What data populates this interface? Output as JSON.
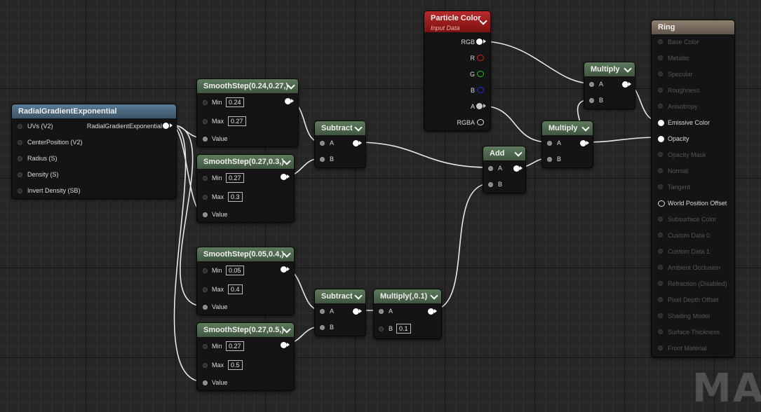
{
  "editor": {
    "watermark": "MAT"
  },
  "nodes": {
    "radial": {
      "title": "RadialGradientExponential",
      "inputs": [
        "UVs (V2)",
        "CenterPosition (V2)",
        "Radius (S)",
        "Density (S)",
        "Invert Density (SB)"
      ],
      "output": "RadialGradientExponential"
    },
    "ss1": {
      "title": "SmoothStep(0.24,0.27,)",
      "min_label": "Min",
      "min_value": "0.24",
      "max_label": "Max",
      "max_value": "0.27",
      "value_label": "Value"
    },
    "ss2": {
      "title": "SmoothStep(0.27,0.3,)",
      "min_label": "Min",
      "min_value": "0.27",
      "max_label": "Max",
      "max_value": "0.3",
      "value_label": "Value"
    },
    "ss3": {
      "title": "SmoothStep(0.05,0.4,)",
      "min_label": "Min",
      "min_value": "0.05",
      "max_label": "Max",
      "max_value": "0.4",
      "value_label": "Value"
    },
    "ss4": {
      "title": "SmoothStep(0.27,0.5,)",
      "min_label": "Min",
      "min_value": "0.27",
      "max_label": "Max",
      "max_value": "0.5",
      "value_label": "Value"
    },
    "sub1": {
      "title": "Subtract",
      "a": "A",
      "b": "B"
    },
    "sub2": {
      "title": "Subtract",
      "a": "A",
      "b": "B"
    },
    "mulconst": {
      "title": "Multiply(,0.1)",
      "a": "A",
      "b": "B",
      "b_value": "0.1"
    },
    "add": {
      "title": "Add",
      "a": "A",
      "b": "B"
    },
    "particle": {
      "title": "Particle Color",
      "subtitle": "Input Data",
      "outputs": [
        "RGB",
        "R",
        "G",
        "B",
        "A",
        "RGBA"
      ]
    },
    "mul_top": {
      "title": "Multiply",
      "a": "A",
      "b": "B"
    },
    "mul_mid": {
      "title": "Multiply",
      "a": "A",
      "b": "B"
    },
    "ring": {
      "title": "Ring",
      "inputs": [
        {
          "label": "Base Color",
          "active": false
        },
        {
          "label": "Metallic",
          "active": false
        },
        {
          "label": "Specular",
          "active": false
        },
        {
          "label": "Roughness",
          "active": false
        },
        {
          "label": "Anisotropy",
          "active": false
        },
        {
          "label": "Emissive Color",
          "active": true
        },
        {
          "label": "Opacity",
          "active": true
        },
        {
          "label": "Opacity Mask",
          "active": false
        },
        {
          "label": "Normal",
          "active": false
        },
        {
          "label": "Tangent",
          "active": false
        },
        {
          "label": "World Position Offset",
          "active": true
        },
        {
          "label": "Subsurface Color",
          "active": false
        },
        {
          "label": "Custom Data 0",
          "active": false
        },
        {
          "label": "Custom Data 1",
          "active": false
        },
        {
          "label": "Ambient Occlusion",
          "active": false
        },
        {
          "label": "Refraction (Disabled)",
          "active": false
        },
        {
          "label": "Pixel Depth Offset",
          "active": false
        },
        {
          "label": "Shading Model",
          "active": false
        },
        {
          "label": "Surface Thickness",
          "active": false
        },
        {
          "label": "Front Material",
          "active": false
        }
      ]
    }
  },
  "colors": {
    "pin_red": "#e02020",
    "pin_green": "#20c020",
    "pin_blue": "#2030e0",
    "wire": "#e8e8e8"
  }
}
